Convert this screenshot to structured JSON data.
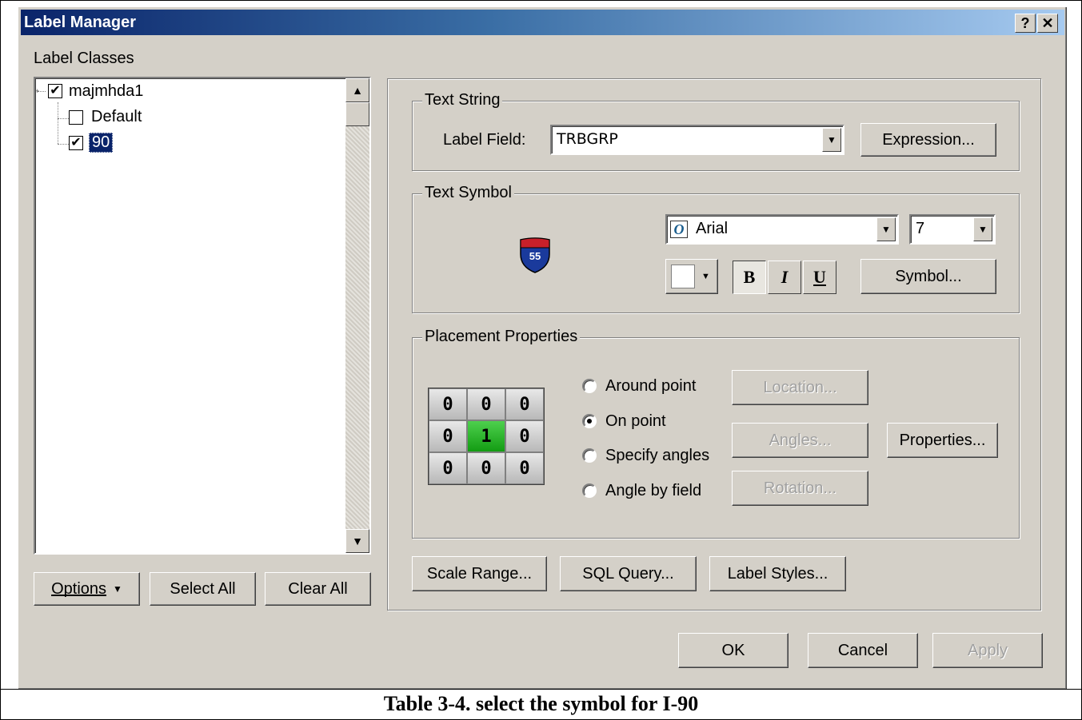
{
  "window": {
    "title": "Label Manager",
    "help_label": "?",
    "close_label": "✕"
  },
  "left": {
    "label_classes": "Label Classes",
    "tree": [
      {
        "label": "majmhda1",
        "checked": true
      },
      {
        "label": "Default",
        "checked": false
      },
      {
        "label": "90",
        "checked": true,
        "selected": true
      }
    ],
    "buttons": {
      "options": "Options",
      "select_all": "Select All",
      "clear_all": "Clear All"
    }
  },
  "text_string": {
    "title": "Text String",
    "label_field_label": "Label Field:",
    "label_field_value": "TRBGRP",
    "expression_button": "Expression..."
  },
  "text_symbol": {
    "title": "Text Symbol",
    "shield_number": "55",
    "font": "Arial",
    "size": "7",
    "bold": "B",
    "italic": "I",
    "underline": "U",
    "symbol_button": "Symbol...",
    "colors": {
      "shield_blue": "#1a3a9c",
      "shield_red": "#c8202a"
    }
  },
  "placement": {
    "title": "Placement Properties",
    "grid": [
      "0",
      "0",
      "0",
      "0",
      "1",
      "0",
      "0",
      "0",
      "0"
    ],
    "options": [
      "Around point",
      "On point",
      "Specify angles",
      "Angle by field"
    ],
    "selected_option": "On point",
    "buttons": {
      "location": "Location...",
      "angles": "Angles...",
      "rotation": "Rotation...",
      "properties": "Properties..."
    }
  },
  "bottom_buttons": {
    "scale_range": "Scale Range...",
    "sql_query": "SQL Query...",
    "label_styles": "Label Styles..."
  },
  "dialog_buttons": {
    "ok": "OK",
    "cancel": "Cancel",
    "apply": "Apply"
  },
  "caption": "Table 3-4. select the symbol for I-90"
}
